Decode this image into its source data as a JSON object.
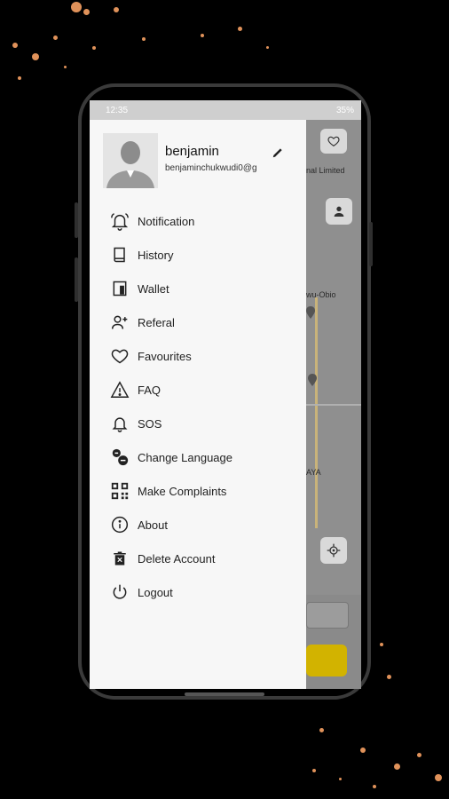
{
  "status_bar": {
    "time": "12:35",
    "battery": "35%"
  },
  "profile": {
    "name": "benjamin",
    "email": "benjaminchukwudi0@g"
  },
  "menu": [
    {
      "label": "Notification",
      "icon": "bell-ring-icon"
    },
    {
      "label": "History",
      "icon": "book-icon"
    },
    {
      "label": "Wallet",
      "icon": "wallet-icon"
    },
    {
      "label": "Referal",
      "icon": "person-add-icon"
    },
    {
      "label": "Favourites",
      "icon": "heart-icon"
    },
    {
      "label": "FAQ",
      "icon": "warning-icon"
    },
    {
      "label": "SOS",
      "icon": "bell-icon"
    },
    {
      "label": "Change Language",
      "icon": "language-icon"
    },
    {
      "label": "Make Complaints",
      "icon": "qr-code-icon"
    },
    {
      "label": "About",
      "icon": "info-icon"
    },
    {
      "label": "Delete Account",
      "icon": "trash-icon"
    },
    {
      "label": "Logout",
      "icon": "power-icon"
    }
  ],
  "map": {
    "labels": [
      "nal Limited",
      "wu-Obio",
      "AYA"
    ]
  },
  "colors": {
    "accent": "#e6c200",
    "drawer_bg": "#f7f7f7",
    "splatter": "#e0925a"
  }
}
